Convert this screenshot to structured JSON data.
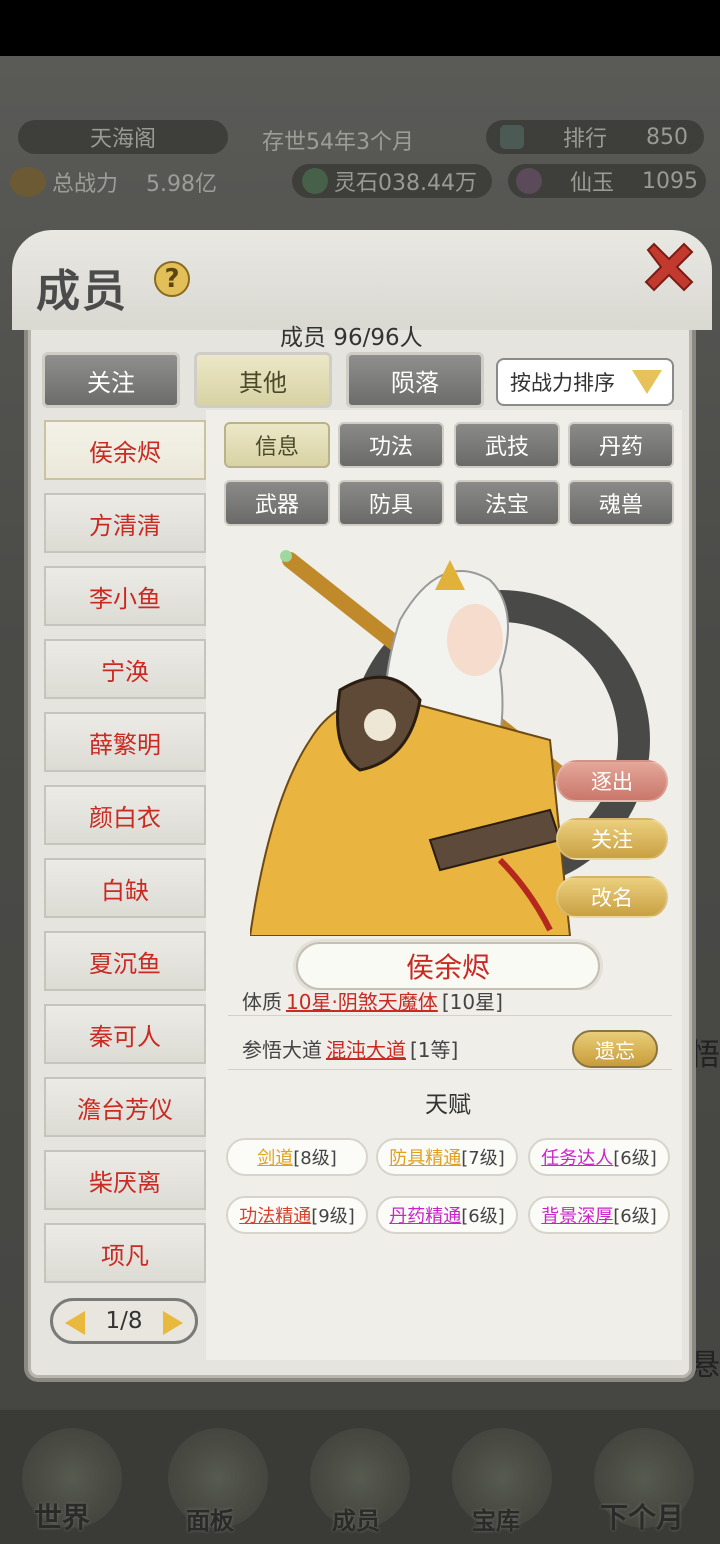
{
  "header": {
    "sect_name": "天海阁",
    "age_text": "存世54年3个月",
    "rank_label": "排行",
    "rank_value": "850",
    "power_label": "总战力",
    "power_value": "5.98亿",
    "spirit_text": "灵石038.44万",
    "jade_label": "仙玉",
    "jade_value": "1095"
  },
  "dialog": {
    "title": "成员",
    "help": "?",
    "member_count": "成员  96/96人",
    "tabs": [
      {
        "label": "关注",
        "active": false
      },
      {
        "label": "其他",
        "active": true
      },
      {
        "label": "陨落",
        "active": false
      }
    ],
    "sort_label": "按战力排序"
  },
  "members": [
    "侯余烬",
    "方清清",
    "李小鱼",
    "宁涣",
    "薛繁明",
    "颜白衣",
    "白缺",
    "夏沉鱼",
    "秦可人",
    "澹台芳仪",
    "柴厌离",
    "项凡"
  ],
  "selected_member": "侯余烬",
  "pager": "1/8",
  "subtabs": [
    {
      "label": "信息",
      "active": true
    },
    {
      "label": "功法",
      "active": false
    },
    {
      "label": "武技",
      "active": false
    },
    {
      "label": "丹药",
      "active": false
    },
    {
      "label": "武器",
      "active": false
    },
    {
      "label": "防具",
      "active": false
    },
    {
      "label": "法宝",
      "active": false
    },
    {
      "label": "魂兽",
      "active": false
    }
  ],
  "actions": {
    "expel": "逐出",
    "follow": "关注",
    "rename": "改名"
  },
  "character_name": "侯余烬",
  "info": {
    "constitution_label": "体质",
    "constitution_value": "10星·阴煞天魔体",
    "constitution_level": "[10星]",
    "dao_label": "参悟大道",
    "dao_value": "混沌大道",
    "dao_level": "[1等]",
    "forget_button": "遗忘"
  },
  "talent_header": "天赋",
  "talents": [
    {
      "name": "剑道",
      "level": "[8级]",
      "color": "#e0a020"
    },
    {
      "name": "防具精通",
      "level": "[7级]",
      "color": "#e0a020"
    },
    {
      "name": "任务达人",
      "level": "[6级]",
      "color": "#cc22cc"
    },
    {
      "name": "功法精通",
      "level": "[9级]",
      "color": "#d8402a"
    },
    {
      "name": "丹药精通",
      "level": "[6级]",
      "color": "#cc22cc"
    },
    {
      "name": "背景深厚",
      "level": "[6级]",
      "color": "#cc22cc"
    }
  ],
  "bottom_nav": [
    "世界",
    "面板",
    "成员",
    "宝库",
    "下个月"
  ],
  "side_fragments": {
    "right1": "悟",
    "right2": "悬"
  }
}
